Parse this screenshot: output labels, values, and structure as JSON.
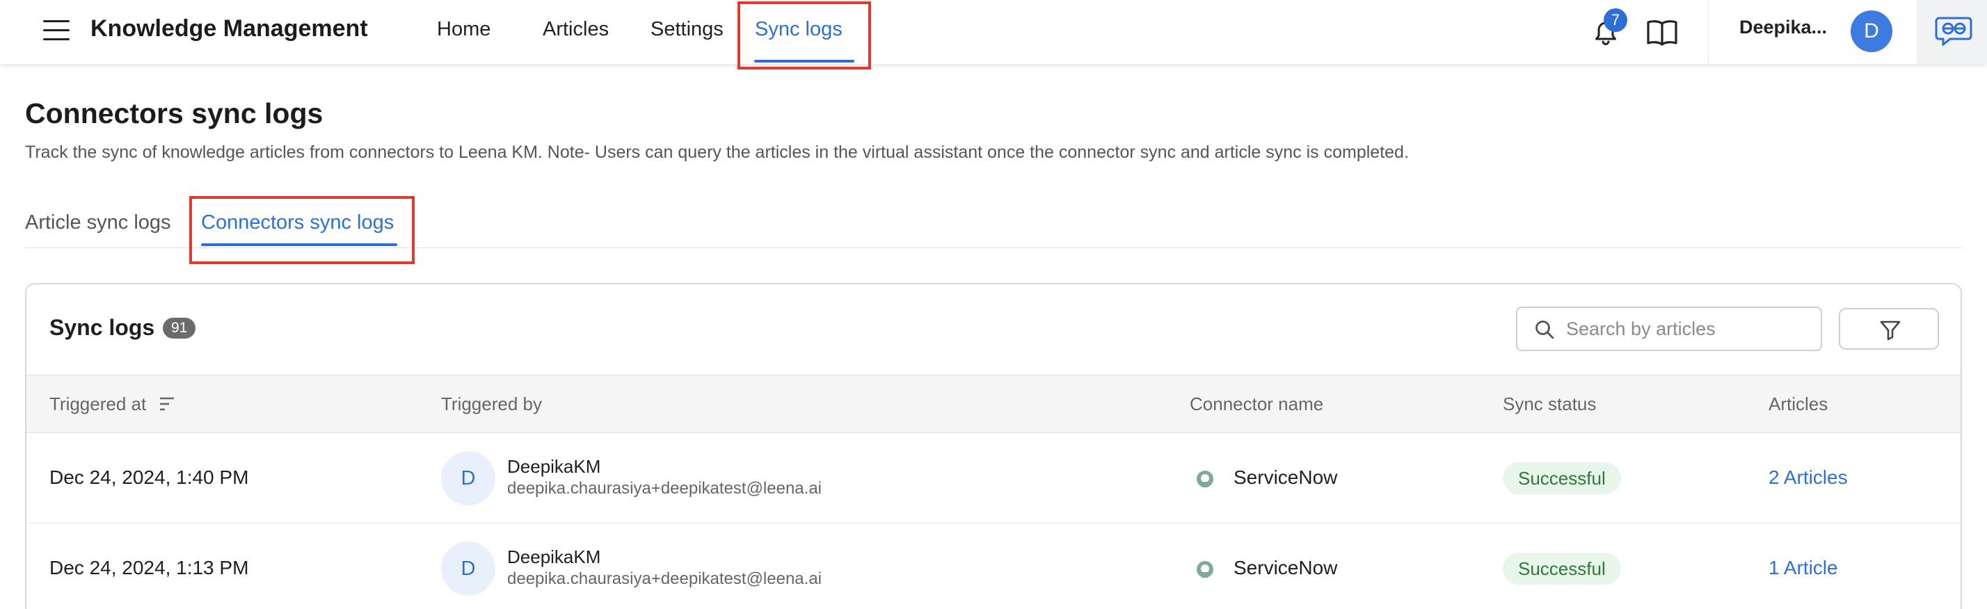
{
  "app": {
    "title": "Knowledge Management"
  },
  "nav": {
    "items": [
      {
        "label": "Home"
      },
      {
        "label": "Articles"
      },
      {
        "label": "Settings"
      },
      {
        "label": "Sync logs",
        "active": true
      }
    ]
  },
  "header": {
    "notification_count": "7",
    "user_name": "Deepika...",
    "user_initial": "D"
  },
  "page": {
    "title": "Connectors sync logs",
    "description": "Track the sync of knowledge articles from connectors to Leena KM. Note- Users can query the articles in the virtual assistant once the connector sync and article sync is completed."
  },
  "tabs": [
    {
      "label": "Article sync logs"
    },
    {
      "label": "Connectors sync logs",
      "active": true
    }
  ],
  "card": {
    "title": "Sync logs",
    "count": "91",
    "search_placeholder": "Search by articles"
  },
  "table": {
    "columns": [
      "Triggered at",
      "Triggered by",
      "Connector name",
      "Sync status",
      "Articles"
    ],
    "rows": [
      {
        "triggered_at": "Dec 24, 2024, 1:40 PM",
        "initial": "D",
        "user": "DeepikaKM",
        "email": "deepika.chaurasiya+deepikatest@leena.ai",
        "connector": "ServiceNow",
        "status": "Successful",
        "articles": "2 Articles"
      },
      {
        "triggered_at": "Dec 24, 2024, 1:13 PM",
        "initial": "D",
        "user": "DeepikaKM",
        "email": "deepika.chaurasiya+deepikatest@leena.ai",
        "connector": "ServiceNow",
        "status": "Successful",
        "articles": "1 Article"
      }
    ]
  },
  "colors": {
    "accent": "#2d6fd6",
    "highlight": "#e23a2a",
    "status_success_bg": "#e8f5ea",
    "status_success_text": "#2f7a3a"
  }
}
